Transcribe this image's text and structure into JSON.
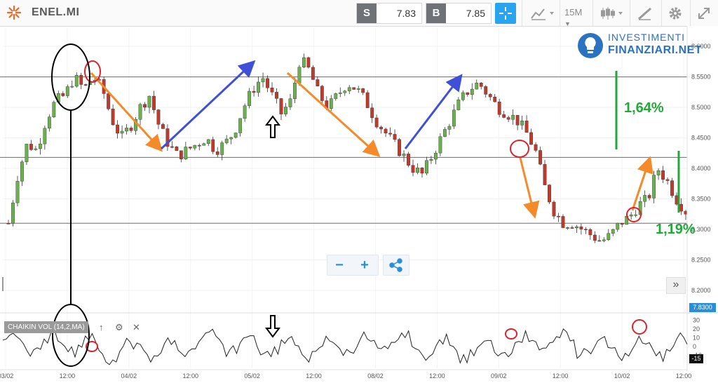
{
  "toolbar": {
    "symbol": "ENEL.MI",
    "sell_label": "S",
    "sell_price": "7.83",
    "buy_label": "B",
    "buy_price": "7.85",
    "interval": "15M",
    "icons": [
      "crosshair-icon",
      "chart-type-icon",
      "interval-dropdown",
      "candles-icon",
      "draw-icon",
      "gear-icon",
      "fullscreen-icon"
    ]
  },
  "brand": {
    "line1": "INVESTIMENTI",
    "line2": "FINANZIARI.NET"
  },
  "colors": {
    "up": "#6ab04c",
    "down": "#c0392b",
    "accent": "#29a5f0",
    "annot_green": "#22a83a",
    "arrow_orange": "#f58a2a",
    "arrow_blue": "#3f4fd8",
    "circle_red": "#e0212b"
  },
  "price_axis": {
    "current_price": "7.8300"
  },
  "oscillator": {
    "label": "CHAIKIN VOL (14,2,MA)",
    "ticks": [
      "30",
      "20",
      "10",
      "0",
      "-10"
    ],
    "current_value": "-15"
  },
  "annotations": {
    "pct_upper": "1,64%",
    "pct_lower": "1,19%"
  },
  "controls": {
    "zoom_out": "−",
    "zoom_in": "+",
    "expand": "»"
  },
  "chart_data": {
    "type": "candlestick",
    "title": "",
    "y_ticks": [
      "8.6000",
      "8.5500",
      "8.5000",
      "8.4500",
      "8.4000",
      "8.3500",
      "8.3000",
      "8.2500",
      "8.2000"
    ],
    "ylim": [
      8.17,
      8.63
    ],
    "x_ticks": [
      "03/02",
      "12:00",
      "04/02",
      "12:00",
      "05/02",
      "12:00",
      "08/02",
      "12:00",
      "09/02",
      "12:00",
      "10/02",
      "12:00"
    ],
    "horizontal_levels": [
      8.55,
      8.418,
      8.31
    ],
    "close_path": [
      8.31,
      8.39,
      8.44,
      8.43,
      8.48,
      8.51,
      8.52,
      8.55,
      8.53,
      8.55,
      8.53,
      8.48,
      8.45,
      8.47,
      8.5,
      8.52,
      8.47,
      8.44,
      8.42,
      8.43,
      8.44,
      8.45,
      8.43,
      8.44,
      8.46,
      8.5,
      8.53,
      8.55,
      8.52,
      8.49,
      8.51,
      8.58,
      8.56,
      8.52,
      8.5,
      8.52,
      8.54,
      8.53,
      8.51,
      8.48,
      8.46,
      8.44,
      8.42,
      8.4,
      8.39,
      8.42,
      8.45,
      8.48,
      8.51,
      8.53,
      8.54,
      8.52,
      8.5,
      8.49,
      8.48,
      8.46,
      8.43,
      8.37,
      8.33,
      8.31,
      8.31,
      8.3,
      8.29,
      8.28,
      8.29,
      8.31,
      8.32,
      8.34,
      8.35,
      8.4,
      8.38,
      8.35,
      8.33
    ]
  }
}
